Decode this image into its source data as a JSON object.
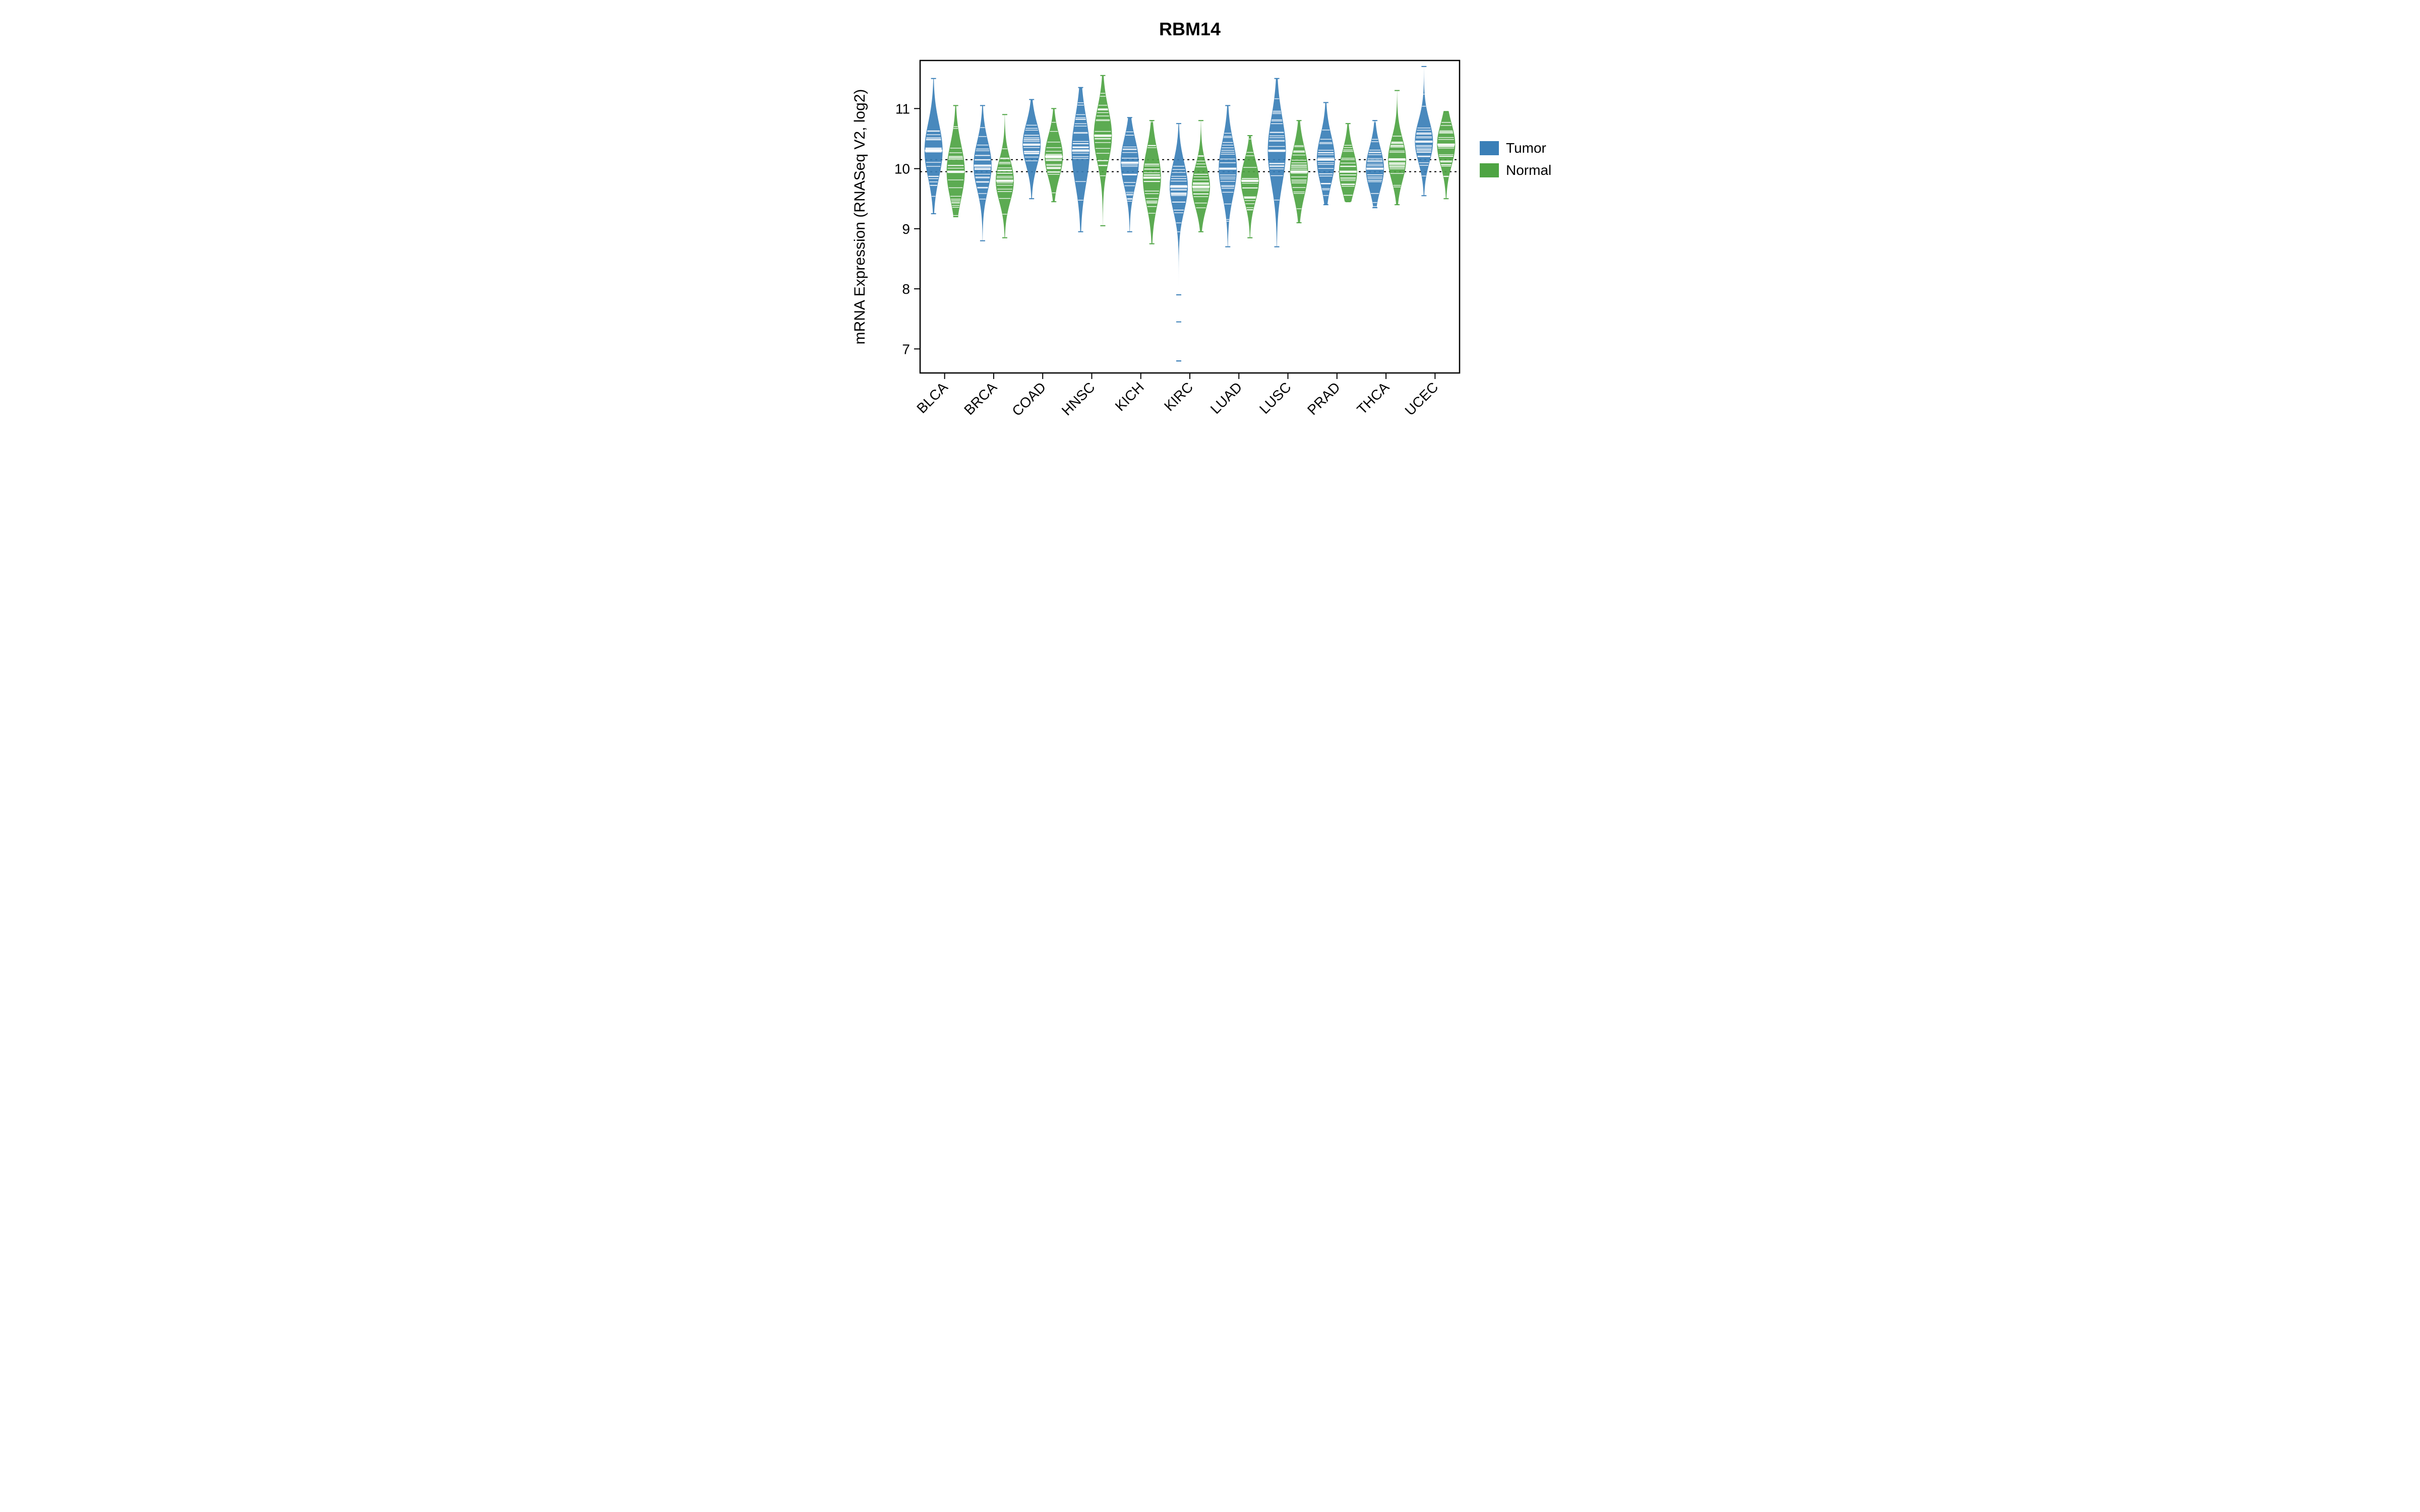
{
  "chart_data": {
    "type": "bar",
    "title": "RBM14",
    "ylabel": "mRNA Expression (RNASeq V2, log2)",
    "xlabel": "",
    "ylim": [
      6.6,
      11.8
    ],
    "yticks": [
      7,
      8,
      9,
      10,
      11
    ],
    "reference_lines": [
      10.15,
      9.95
    ],
    "categories": [
      "BLCA",
      "BRCA",
      "COAD",
      "HNSC",
      "KICH",
      "KIRC",
      "LUAD",
      "LUSC",
      "PRAD",
      "THCA",
      "UCEC"
    ],
    "legend": {
      "tumor": "Tumor",
      "normal": "Normal"
    },
    "colors": {
      "tumor": "#3a7fb7",
      "normal": "#4ea443"
    },
    "series": [
      {
        "name": "Tumor",
        "color": "#3a7fb7",
        "groups": {
          "BLCA": {
            "median": 10.3,
            "spread": 0.45,
            "range": [
              9.25,
              11.5
            ]
          },
          "BRCA": {
            "median": 10.05,
            "spread": 0.4,
            "range": [
              8.8,
              11.05
            ]
          },
          "COAD": {
            "median": 10.4,
            "spread": 0.35,
            "range": [
              9.5,
              11.15
            ]
          },
          "HNSC": {
            "median": 10.3,
            "spread": 0.55,
            "range": [
              8.95,
              11.35
            ]
          },
          "KICH": {
            "median": 10.1,
            "spread": 0.4,
            "range": [
              8.95,
              10.85
            ]
          },
          "KIRC": {
            "median": 9.7,
            "spread": 0.4,
            "range": [
              6.8,
              10.75
            ]
          },
          "LUAD": {
            "median": 10.0,
            "spread": 0.45,
            "range": [
              8.7,
              11.05
            ]
          },
          "LUSC": {
            "median": 10.3,
            "spread": 0.55,
            "range": [
              8.7,
              11.5
            ]
          },
          "PRAD": {
            "median": 10.15,
            "spread": 0.4,
            "range": [
              9.4,
              11.1
            ]
          },
          "THCA": {
            "median": 10.0,
            "spread": 0.35,
            "range": [
              9.35,
              10.8
            ]
          },
          "UCEC": {
            "median": 10.45,
            "spread": 0.35,
            "range": [
              9.55,
              11.7
            ]
          }
        }
      },
      {
        "name": "Normal",
        "color": "#4ea443",
        "groups": {
          "BLCA": {
            "median": 9.95,
            "spread": 0.45,
            "range": [
              9.2,
              11.05
            ]
          },
          "BRCA": {
            "median": 9.8,
            "spread": 0.35,
            "range": [
              8.85,
              10.9
            ]
          },
          "COAD": {
            "median": 10.2,
            "spread": 0.35,
            "range": [
              9.45,
              11.0
            ]
          },
          "HNSC": {
            "median": 10.55,
            "spread": 0.45,
            "range": [
              9.05,
              11.55
            ]
          },
          "KICH": {
            "median": 9.85,
            "spread": 0.45,
            "range": [
              8.75,
              10.8
            ]
          },
          "KIRC": {
            "median": 9.7,
            "spread": 0.35,
            "range": [
              8.95,
              10.8
            ]
          },
          "LUAD": {
            "median": 9.8,
            "spread": 0.35,
            "range": [
              8.85,
              10.55
            ]
          },
          "LUSC": {
            "median": 9.95,
            "spread": 0.4,
            "range": [
              9.1,
              10.8
            ]
          },
          "PRAD": {
            "median": 9.95,
            "spread": 0.35,
            "range": [
              9.45,
              10.75
            ]
          },
          "THCA": {
            "median": 10.15,
            "spread": 0.35,
            "range": [
              9.4,
              11.3
            ]
          },
          "UCEC": {
            "median": 10.4,
            "spread": 0.35,
            "range": [
              9.5,
              10.95
            ]
          }
        }
      }
    ]
  }
}
